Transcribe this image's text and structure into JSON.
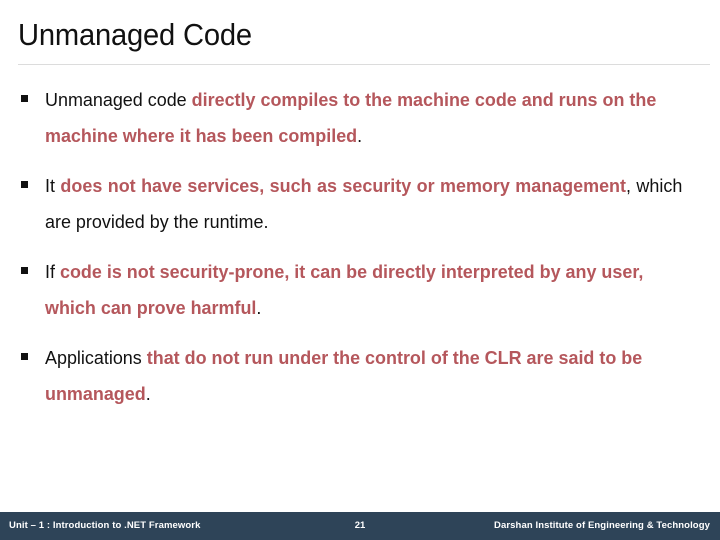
{
  "slide": {
    "title": "Unmanaged Code",
    "colors": {
      "accent_red": "#b5575c",
      "text_black": "#111111",
      "footer_bar": "#2e4458",
      "divider": "#dcdcdc",
      "background": "#ffffff"
    },
    "bullets": [
      {
        "marker": "square-bullet",
        "justified": false,
        "runs": [
          {
            "text": "Unmanaged code ",
            "style": "black"
          },
          {
            "text": "directly compiles to the machine code and runs on the machine where it has been compiled",
            "style": "red"
          },
          {
            "text": ".",
            "style": "black"
          }
        ]
      },
      {
        "marker": "square-bullet",
        "justified": true,
        "runs": [
          {
            "text": "It ",
            "style": "black"
          },
          {
            "text": "does not have services, such as security or memory management",
            "style": "red"
          },
          {
            "text": ", which are provided by the runtime.",
            "style": "black"
          }
        ]
      },
      {
        "marker": "square-bullet",
        "justified": false,
        "runs": [
          {
            "text": "If ",
            "style": "black"
          },
          {
            "text": "code is not security-prone, it can be directly interpreted by any user, which can prove harmful",
            "style": "red"
          },
          {
            "text": ".",
            "style": "black"
          }
        ]
      },
      {
        "marker": "square-bullet",
        "justified": false,
        "runs": [
          {
            "text": "Applications ",
            "style": "black"
          },
          {
            "text": "that do not run under the control of the CLR are said to be unmanaged",
            "style": "red"
          },
          {
            "text": ".",
            "style": "black"
          }
        ]
      }
    ]
  },
  "footer": {
    "unit_label": "Unit – 1 : Introduction to .NET Framework",
    "page_number": "21",
    "institute": "Darshan Institute of Engineering & Technology"
  }
}
